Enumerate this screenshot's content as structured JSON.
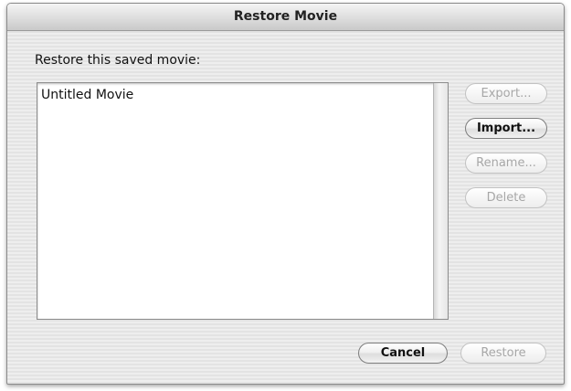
{
  "window": {
    "title": "Restore Movie"
  },
  "prompt_label": "Restore this saved movie:",
  "movie_list": {
    "items": [
      "Untitled Movie"
    ]
  },
  "side_buttons": {
    "export_label": "Export...",
    "import_label": "Import...",
    "rename_label": "Rename...",
    "delete_label": "Delete"
  },
  "footer_buttons": {
    "cancel_label": "Cancel",
    "restore_label": "Restore"
  }
}
